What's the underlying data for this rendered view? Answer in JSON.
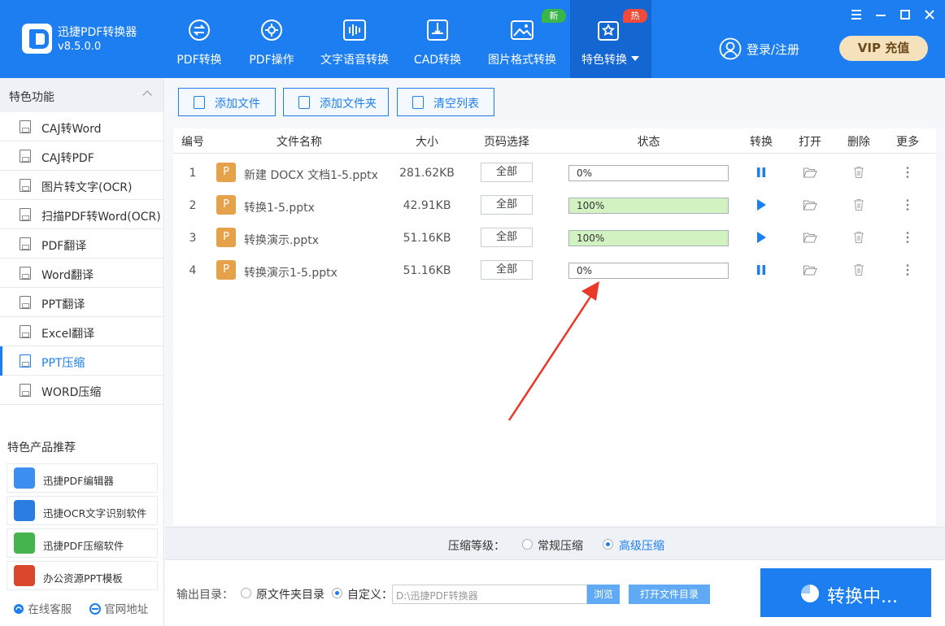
{
  "app": {
    "name": "迅捷PDF转换器",
    "version": "v8.5.0.0"
  },
  "nav": [
    {
      "label": "PDF转换",
      "icon": "convert-cycle-icon"
    },
    {
      "label": "PDF操作",
      "icon": "gear-icon"
    },
    {
      "label": "文字语音转换",
      "icon": "audio-wave-icon"
    },
    {
      "label": "CAD转换",
      "icon": "cad-icon"
    },
    {
      "label": "图片格式转换",
      "icon": "image-icon",
      "badge": "新"
    },
    {
      "label": "特色转换",
      "icon": "star-box-icon",
      "badge": "热"
    }
  ],
  "header": {
    "login": "登录/注册",
    "vip": "VIP 充值"
  },
  "sidebar": {
    "title": "特色功能",
    "items": [
      {
        "label": "CAJ转Word"
      },
      {
        "label": "CAJ转PDF"
      },
      {
        "label": "图片转文字(OCR)"
      },
      {
        "label": "扫描PDF转Word(OCR)"
      },
      {
        "label": "PDF翻译"
      },
      {
        "label": "Word翻译"
      },
      {
        "label": "PPT翻译"
      },
      {
        "label": "Excel翻译"
      },
      {
        "label": "PPT压缩"
      },
      {
        "label": "WORD压缩"
      }
    ],
    "promo_title": "特色产品推荐",
    "promos": [
      {
        "label": "迅捷PDF编辑器"
      },
      {
        "label": "迅捷OCR文字识别软件"
      },
      {
        "label": "迅捷PDF压缩软件"
      },
      {
        "label": "办公资源PPT模板"
      }
    ],
    "footer": {
      "service": "在线客服",
      "website": "官网地址"
    }
  },
  "toolbar": {
    "add_file": "添加文件",
    "add_folder": "添加文件夹",
    "clear": "清空列表"
  },
  "table": {
    "headers": {
      "no": "编号",
      "name": "文件名称",
      "size": "大小",
      "pages": "页码选择",
      "status": "状态",
      "convert": "转换",
      "open": "打开",
      "delete": "删除",
      "more": "更多"
    },
    "rows": [
      {
        "no": "1",
        "icon": "P",
        "name": "新建 DOCX 文档1-5.pptx",
        "size": "281.62KB",
        "pages": "全部",
        "progress": 0,
        "progress_text": "0%",
        "state": "pause"
      },
      {
        "no": "2",
        "icon": "P",
        "name": "转换1-5.pptx",
        "size": "42.91KB",
        "pages": "全部",
        "progress": 100,
        "progress_text": "100%",
        "state": "play"
      },
      {
        "no": "3",
        "icon": "P",
        "name": "转换演示.pptx",
        "size": "51.16KB",
        "pages": "全部",
        "progress": 100,
        "progress_text": "100%",
        "state": "play"
      },
      {
        "no": "4",
        "icon": "P",
        "name": "转换演示1-5.pptx",
        "size": "51.16KB",
        "pages": "全部",
        "progress": 0,
        "progress_text": "0%",
        "state": "pause"
      }
    ]
  },
  "compress": {
    "label": "压缩等级：",
    "normal": "常规压缩",
    "advanced": "高级压缩",
    "selected": "advanced"
  },
  "output": {
    "label": "输出目录：",
    "original": "原文件夹目录",
    "custom": "自定义：",
    "path": "D:\\迅捷PDF转换器",
    "browse": "浏览",
    "open_dir": "打开文件目录",
    "selected": "custom"
  },
  "convert_button": "转换中...",
  "colors": {
    "primary": "#1d7ef2",
    "progress_done": "#d3f2c2",
    "file_icon": "#e6a24b",
    "badge_new": "#39b54a",
    "badge_hot": "#f04b3a",
    "annotation_arrow": "#e8392b"
  }
}
